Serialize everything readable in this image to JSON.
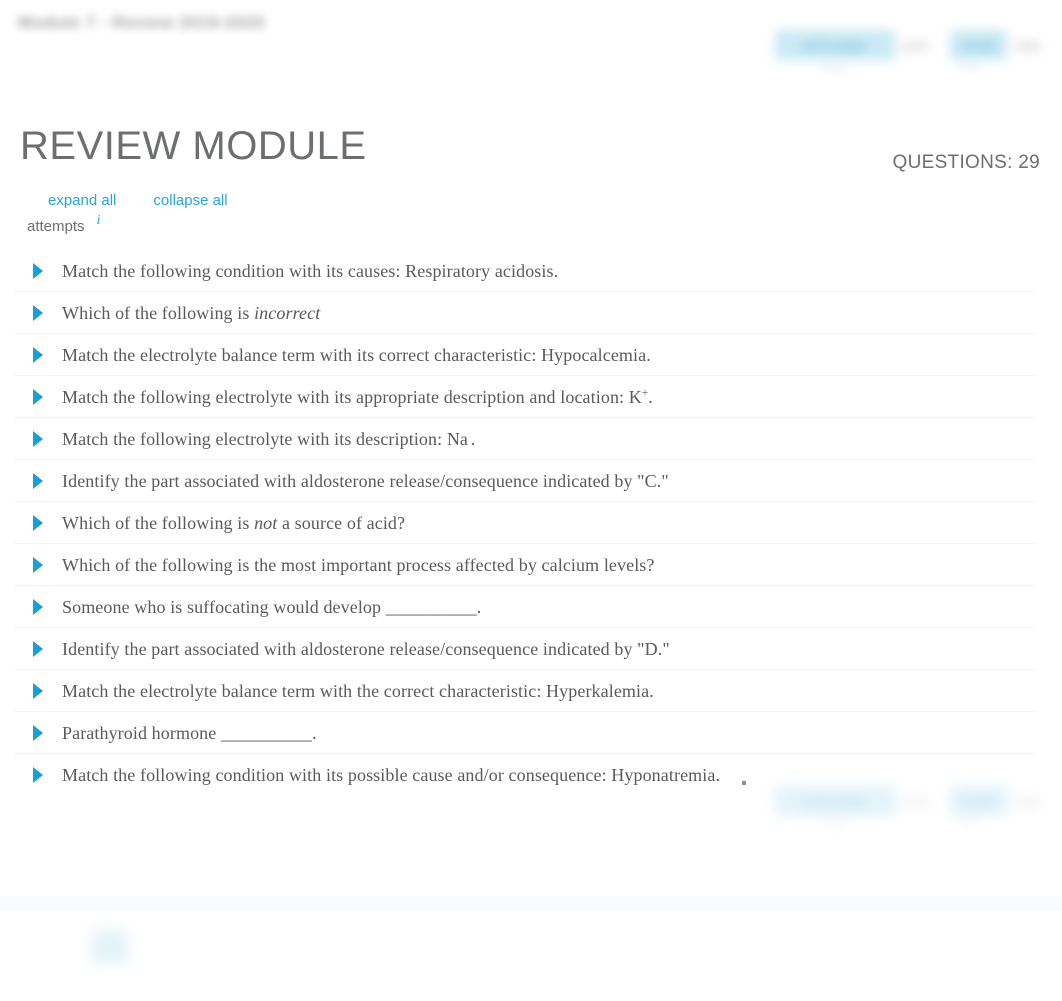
{
  "topbar": {
    "breadcrumb": "Module 7 - Review 2019-2020",
    "buttons": [
      {
        "label": "print page",
        "caption": "print"
      },
      {
        "label": "email",
        "caption": "help"
      }
    ],
    "sub_captions": [
      "page",
      "help"
    ]
  },
  "header": {
    "page_title": "REVIEW MODULE",
    "questions_count": "QUESTIONS: 29"
  },
  "toolbar": {
    "expand_all": "expand all",
    "collapse_all": "collapse all",
    "attempts_label": "attempts",
    "info_icon": "i"
  },
  "questions": [
    {
      "id": 1,
      "html": "Match the following condition with its causes: Respiratory acidosis."
    },
    {
      "id": 2,
      "html": "Which of the following is <i>incorrect</i>"
    },
    {
      "id": 3,
      "html": "Match the electrolyte balance term with its correct characteristic: Hypocalcemia."
    },
    {
      "id": 4,
      "html": "Match the following electrolyte with its appropriate description and location: K<sup>+</sup>."
    },
    {
      "id": 5,
      "html": "Match the following electrolyte with its description: Na<sup> </sup>."
    },
    {
      "id": 6,
      "html": "Identify the part associated with aldosterone release/consequence indicated by \"C.\""
    },
    {
      "id": 7,
      "html": "Which of the following is <i>not</i> a source of acid?"
    },
    {
      "id": 8,
      "html": "Which of the following is the most important process affected by calcium levels?"
    },
    {
      "id": 9,
      "html": "Someone who is suffocating would develop __________."
    },
    {
      "id": 10,
      "html": "Identify the part associated with aldosterone release/consequence indicated by \"D.\""
    },
    {
      "id": 11,
      "html": "Match the electrolyte balance term with the correct characteristic: Hyperkalemia."
    },
    {
      "id": 12,
      "html": "Parathyroid hormone __________."
    },
    {
      "id": 13,
      "html": "Match the following condition with its possible cause and/or consequence: Hyponatremia."
    }
  ],
  "footer": {
    "buttons": [
      {
        "label": "print page",
        "caption": "print"
      },
      {
        "label": "email",
        "caption": "help"
      }
    ],
    "sub_captions": [
      "page",
      "help"
    ]
  },
  "colors": {
    "accent": "#2ea3d4",
    "triangle": "#1a9fd4",
    "text": "#58595b",
    "title": "#6d6e70",
    "divider": "#f4f4f5"
  }
}
